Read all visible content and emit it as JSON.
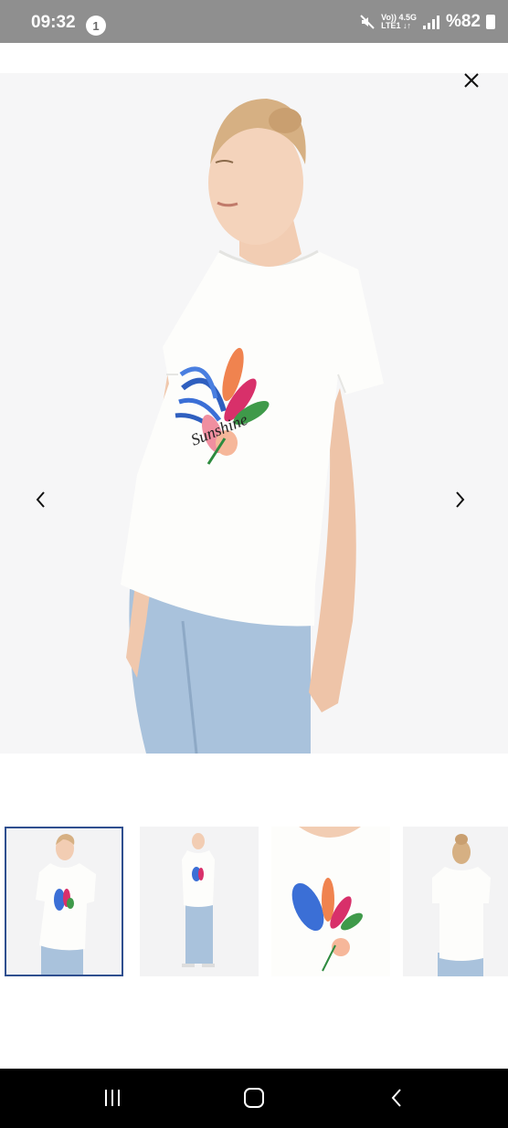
{
  "status_bar": {
    "time": "09:32",
    "notification_count": "1",
    "network_line1": "Vo)) 4.5G",
    "network_line2": "LTE1 ↓↑",
    "battery": "%82"
  },
  "product": {
    "print_text": "Sunshine"
  },
  "gallery": {
    "selected_index": 0,
    "thumbnails": [
      "front-angled",
      "full-body",
      "print-closeup",
      "back-view"
    ]
  },
  "colors": {
    "accent_border": "#2f4f8f",
    "status_bar_bg": "#8f8f8f"
  }
}
